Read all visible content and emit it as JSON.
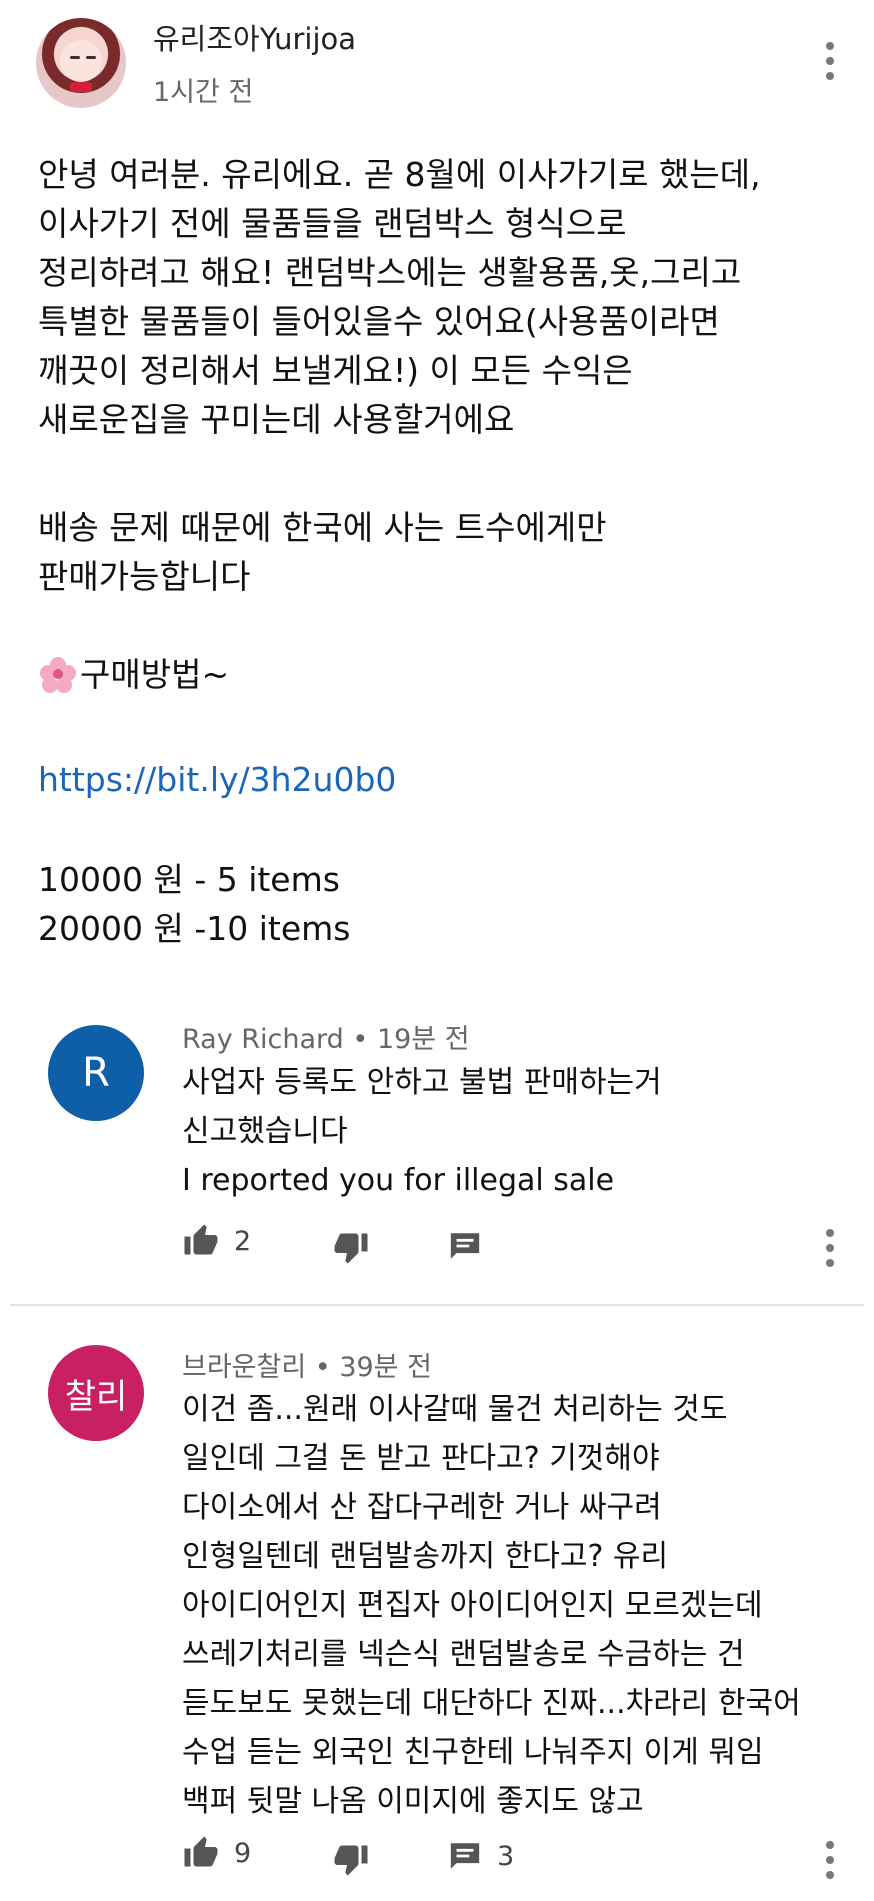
{
  "post": {
    "author": "유리조아Yurijoa",
    "timestamp": "1시간 전",
    "paragraph1": "안녕 여러분. 유리에요. 곧 8월에 이사가기로 했는데,\n이사가기 전에 물품들을 랜덤박스 형식으로\n정리하려고 해요! 랜덤박스에는 생활용품,옷,그리고\n특별한 물품들이 들어있을수 있어요(사용품이라면\n깨끗이 정리해서 보낼게요!) 이 모든 수익은\n새로운집을 꾸미는데 사용할거에요",
    "paragraph2": "배송 문제 때문에 한국에 사는 트수에게만\n판매가능합니다",
    "how_to_buy": "구매방법~",
    "link": "https://bit.ly/3h2u0b0",
    "prices": "10000 원 - 5 items\n20000 원 -10 items"
  },
  "replies": [
    {
      "avatar_letter": "R",
      "avatar_color": "#0f5ea8",
      "author": "Ray Richard",
      "time": "19분 전",
      "text": "사업자 등록도 안하고 불법 판매하는거\n신고했습니다\nI reported you for illegal sale",
      "likes": "2",
      "reply_count": ""
    },
    {
      "avatar_letter": "찰리",
      "avatar_color": "#c91f63",
      "author": "브라운찰리",
      "time": "39분 전",
      "text": "이건 좀...원래 이사갈때 물건 처리하는 것도\n일인데 그걸 돈 받고 판다고? 기껏해야\n다이소에서 산 잡다구레한 거나 싸구려\n인형일텐데 랜덤발송까지 한다고? 유리\n아이디어인지 편집자 아이디어인지 모르겠는데\n쓰레기처리를 넥슨식 랜덤발송로 수금하는 건\n듣도보도 못했는데 대단하다 진짜...차라리 한국어\n수업 듣는 외국인 친구한테 나눠주지 이게 뭐임\n백퍼 뒷말 나옴 이미지에 좋지도 않고",
      "likes": "9",
      "reply_count": "3"
    }
  ],
  "separator": "•",
  "icons": [
    "thumb-up-icon",
    "thumb-down-icon",
    "comment-icon",
    "more-vert-icon",
    "cherry-blossom-icon"
  ]
}
